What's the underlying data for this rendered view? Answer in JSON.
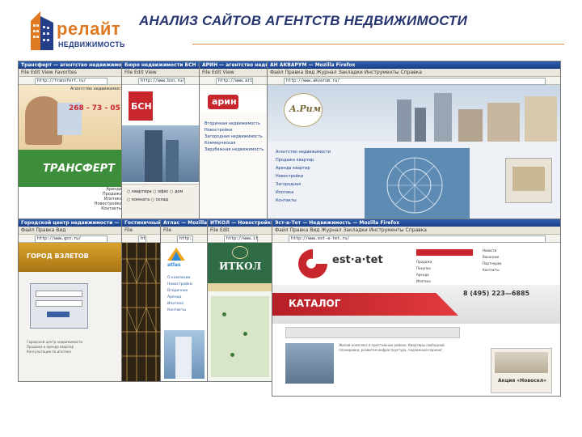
{
  "logo": {
    "name": "релайт",
    "subtitle": "НЕДВИЖИМОСТЬ"
  },
  "title": "АНАЛИЗ САЙТОВ АГЕНТСТВ НЕДВИЖИМОСТИ",
  "shots": {
    "s1": {
      "title": "Трансферт — агентство недвижимости — Windows Internet Explorer",
      "url": "http://transfert.ru/",
      "phone": "268 - 73 - 05",
      "brand": "ТРАНСФЕРТ"
    },
    "s2": {
      "title": "Бюро недвижимости БСН — Microsoft Internet Explorer",
      "url": "http://www.bsn.ru/",
      "brand": "БСН"
    },
    "s3": {
      "title": "АРИН — агентство недвижимости",
      "url": "http://www.arin.ru/",
      "brand": "арин",
      "menu": [
        "Вторичная недвижимость",
        "Новостройки",
        "Загородная недвижимость",
        "Коммерческая",
        "Зарубежная недвижимость"
      ]
    },
    "s4": {
      "title": "АН АКВАРУМ — Mozilla Firefox",
      "url": "http://www.akvarum.ru/",
      "brand": "A.Рим"
    },
    "s5": {
      "title": "Городской центр недвижимости — Mozilla Firefox",
      "url": "http://www.gcn.ru/",
      "brand": "ГОРОД ВЗЛЕТОВ"
    },
    "s6": {
      "title": "Гостиничный комплекс",
      "url": "http://www.estate.ru/"
    },
    "s7": {
      "title": "Атлас — Mozilla Firefox",
      "url": "http://www.atlas.ru/",
      "brand": "atlas"
    },
    "s8": {
      "title": "ИТКОЛ — Новостройки — Mozilla Firefox",
      "url": "http://www.itkol.ru/",
      "brand": "ИТКОЛ"
    },
    "s9": {
      "title": "Эст-а-Тет — Недвижимость — Mozilla Firefox",
      "url": "http://www.est-a-tet.ru/",
      "brand": "est·a·tet",
      "catalog": "КАТАЛОГ",
      "phone": "8 (495) 223—6885",
      "promo": "Акция «Новосел»"
    }
  },
  "colors": {
    "accent": "#e07a22",
    "navy": "#26356f",
    "red": "#c8262d"
  }
}
